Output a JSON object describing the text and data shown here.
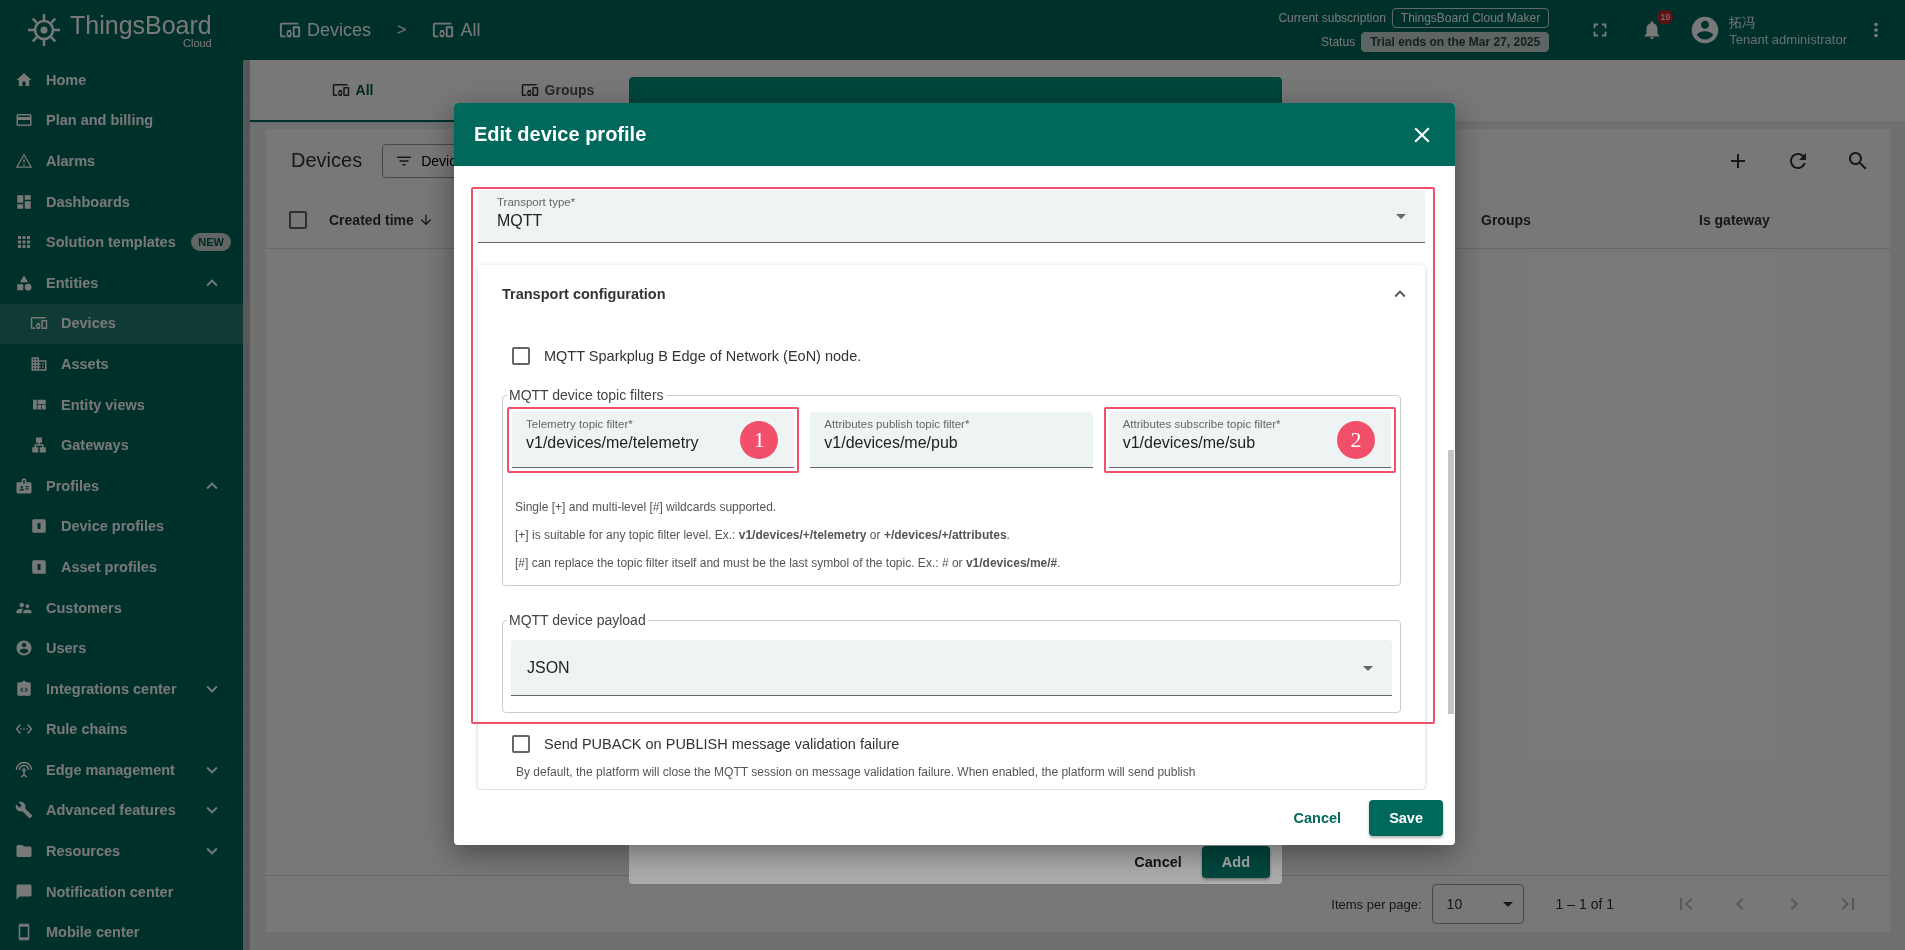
{
  "topbar": {
    "brand": "ThingsBoard",
    "brand_sub": "Cloud",
    "breadcrumbs": [
      {
        "label": "Devices"
      },
      {
        "label": "All"
      }
    ],
    "separator": ">",
    "subscription": {
      "label": "Current subscription",
      "value": "ThingsBoard Cloud Maker"
    },
    "status": {
      "label": "Status",
      "value": "Trial ends on the Mar 27, 2025"
    },
    "notifications": "19",
    "user": {
      "name": "拓冯",
      "role": "Tenant administrator"
    }
  },
  "sidebar": {
    "items": [
      {
        "kind": "link",
        "label": "Home",
        "selected": false
      },
      {
        "kind": "link",
        "label": "Plan and billing",
        "selected": false
      },
      {
        "kind": "link",
        "label": "Alarms",
        "selected": false
      },
      {
        "kind": "link",
        "label": "Dashboards",
        "selected": false
      },
      {
        "kind": "link",
        "label": "Solution templates",
        "selected": false,
        "badge": "NEW"
      },
      {
        "kind": "group",
        "label": "Entities",
        "selected": false,
        "expanded": true,
        "children": [
          {
            "label": "Devices",
            "selected": true
          },
          {
            "label": "Assets",
            "selected": false
          },
          {
            "label": "Entity views",
            "selected": false
          },
          {
            "label": "Gateways",
            "selected": false
          }
        ]
      },
      {
        "kind": "group",
        "label": "Profiles",
        "selected": false,
        "expanded": true,
        "children": [
          {
            "label": "Device profiles",
            "selected": false
          },
          {
            "label": "Asset profiles",
            "selected": false
          }
        ]
      },
      {
        "kind": "link",
        "label": "Customers",
        "selected": false
      },
      {
        "kind": "link",
        "label": "Users",
        "selected": false
      },
      {
        "kind": "group",
        "label": "Integrations center",
        "selected": false,
        "expanded": false
      },
      {
        "kind": "link",
        "label": "Rule chains",
        "selected": false
      },
      {
        "kind": "group",
        "label": "Edge management",
        "selected": false,
        "expanded": false
      },
      {
        "kind": "group",
        "label": "Advanced features",
        "selected": false,
        "expanded": false
      },
      {
        "kind": "group",
        "label": "Resources",
        "selected": false,
        "expanded": false
      },
      {
        "kind": "link",
        "label": "Notification center",
        "selected": false
      },
      {
        "kind": "link",
        "label": "Mobile center",
        "selected": false
      }
    ]
  },
  "tabs": [
    {
      "label": "All",
      "selected": true
    },
    {
      "label": "Groups",
      "selected": false
    }
  ],
  "devices": {
    "title": "Devices",
    "filter_button": "Devic",
    "header_checkbox": {
      "checked": false
    },
    "columns": [
      {
        "label": "Created time",
        "sorted_descending": true
      },
      {
        "label": "Groups"
      },
      {
        "label": "Is gateway"
      }
    ],
    "paginator": {
      "label": "Items per page:",
      "page_size": "10",
      "range": "1 – 1 of 1"
    }
  },
  "back_dialog": {
    "buttons": [
      {
        "kind": "text",
        "label": "Cancel"
      },
      {
        "kind": "primary",
        "label": "Add"
      }
    ]
  },
  "dialog": {
    "title": "Edit device profile",
    "transport_highlighted": true,
    "transport_type": {
      "label": "Transport type*",
      "value": "MQTT"
    },
    "transport_config": {
      "title": "Transport configuration",
      "expanded": true,
      "sparkplug": {
        "label": "MQTT Sparkplug B Edge of Network (EoN) node.",
        "checked": false
      },
      "topic_filters": {
        "legend": "MQTT device topic filters",
        "fields": [
          {
            "label": "Telemetry topic filter*",
            "value": "v1/devices/me/telemetry",
            "highlighted": true,
            "callout": "1"
          },
          {
            "label": "Attributes publish topic filter*",
            "value": "v1/devices/me/pub",
            "highlighted": false
          },
          {
            "label": "Attributes subscribe topic filter*",
            "value": "v1/devices/me/sub",
            "highlighted": true,
            "callout": "2"
          }
        ],
        "help": [
          "Single [+] and multi-level [#] wildcards supported.",
          "[+] is suitable for any topic filter level. Ex.: **v1/devices/+/telemetry** or **+/devices/+/attributes**.",
          "[#] can replace the topic filter itself and must be the last symbol of the topic. Ex.: # or **v1/devices/me/#**."
        ]
      },
      "payload": {
        "legend": "MQTT device payload",
        "value": "JSON"
      },
      "puback": {
        "label": "Send PUBACK on PUBLISH message validation failure",
        "checked": false,
        "hint": "By default, the platform will close the MQTT session on message validation failure. When enabled, the platform will send publish"
      }
    },
    "buttons": [
      {
        "kind": "text",
        "label": "Cancel"
      },
      {
        "kind": "primary",
        "label": "Save"
      }
    ]
  }
}
